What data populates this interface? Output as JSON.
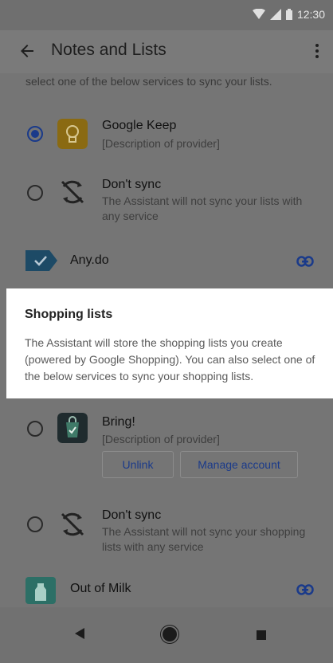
{
  "status_bar": {
    "time": "12:30"
  },
  "app_bar": {
    "title": "Notes and Lists"
  },
  "notes_section": {
    "intro_text": "select one of the below services to sync your lists.",
    "options": [
      {
        "title": "Google Keep",
        "description": "[Description of provider]",
        "selected": true,
        "icon": "google-keep-icon"
      },
      {
        "title": "Don't sync",
        "description": "The Assistant will not sync your lists with any service",
        "selected": false,
        "icon": "sync-off-icon"
      }
    ],
    "linked_app": {
      "name": "Any.do",
      "icon": "anydo-icon"
    }
  },
  "shopping_card": {
    "title": "Shopping lists",
    "body": "The Assistant will store the shopping lists you create (powered by Google Shopping). You can also select one of the below services to sync your shopping lists."
  },
  "shopping_section": {
    "options": [
      {
        "title": "Bring!",
        "description": "[Description of provider]",
        "selected": false,
        "icon": "bring-icon"
      },
      {
        "title": "Don't sync",
        "description": "The Assistant will not sync your shopping lists with any service",
        "selected": false,
        "icon": "sync-off-icon"
      }
    ],
    "buttons": {
      "unlink": "Unlink",
      "manage": "Manage account"
    },
    "linked_app": {
      "name": "Out of Milk",
      "icon": "out-of-milk-icon"
    }
  },
  "colors": {
    "accent": "#1a3a8a",
    "scrim": "#757575",
    "card": "#ffffff"
  }
}
